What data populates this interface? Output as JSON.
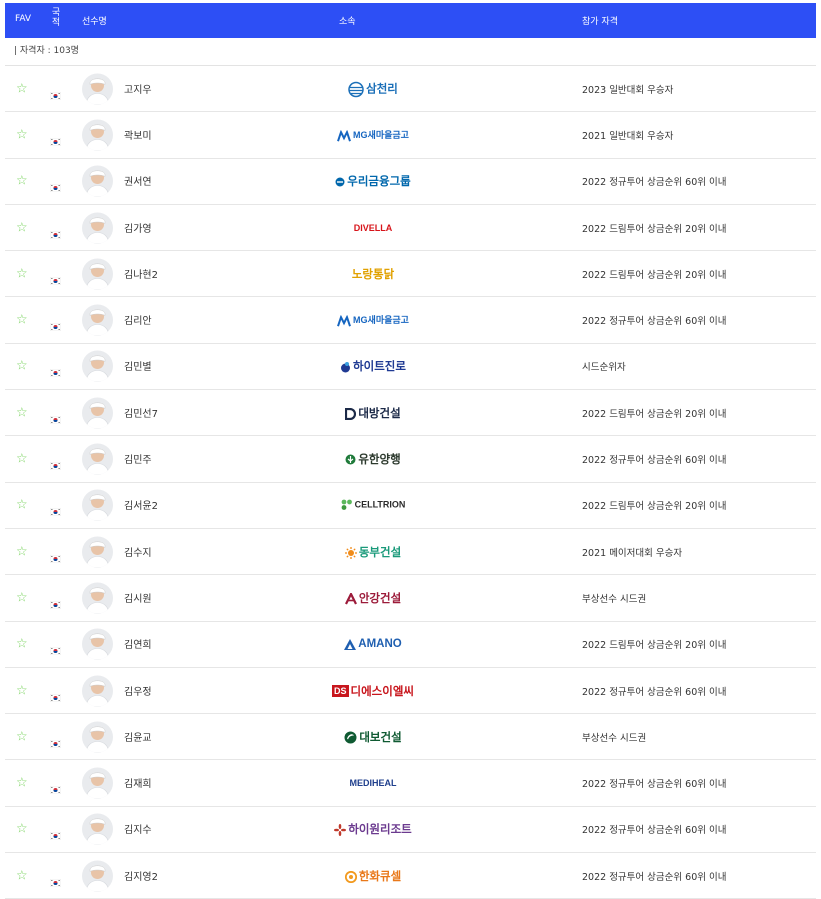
{
  "header": {
    "fav": "FAV",
    "nationality": "국적",
    "player": "선수명",
    "affiliation": "소속",
    "qualification": "참가 자격"
  },
  "count_text": "| 자격자 : 103명",
  "colors": {
    "header_bg": "#2d4ff5",
    "star": "#7ad35f"
  },
  "rows": [
    {
      "name": "고지우",
      "sponsor": "삼천리",
      "sponsor_color": "#1b6fb8",
      "sponsor_icon": "globe-icon",
      "qual": "2023 일반대회 우승자"
    },
    {
      "name": "곽보미",
      "sponsor": "MG새마을금고",
      "sponsor_color": "#1565c0",
      "sponsor_icon": "mg-icon",
      "qual": "2021 일반대회 우승자"
    },
    {
      "name": "권서연",
      "sponsor": "우리금융그룹",
      "sponsor_color": "#0067ac",
      "sponsor_icon": "circle-icon",
      "qual": "2022 정규투어 상금순위 60위 이내"
    },
    {
      "name": "김가영",
      "sponsor": "DIVELLA",
      "sponsor_color": "#d7141a",
      "sponsor_icon": "",
      "qual": "2022 드림투어 상금순위 20위 이내"
    },
    {
      "name": "김나현2",
      "sponsor": "노랑통닭",
      "sponsor_color": "#e1a100",
      "sponsor_icon": "",
      "qual": "2022 드림투어 상금순위 20위 이내"
    },
    {
      "name": "김리안",
      "sponsor": "MG새마을금고",
      "sponsor_color": "#1565c0",
      "sponsor_icon": "mg-icon",
      "qual": "2022 정규투어 상금순위 60위 이내"
    },
    {
      "name": "김민별",
      "sponsor": "하이트진로",
      "sponsor_color": "#1f3a93",
      "sponsor_icon": "drop-icon",
      "qual": "시드순위자"
    },
    {
      "name": "김민선7",
      "sponsor": "대방건설",
      "sponsor_color": "#1c2a48",
      "sponsor_icon": "d-icon",
      "qual": "2022 드림투어 상금순위 20위 이내"
    },
    {
      "name": "김민주",
      "sponsor": "유한양행",
      "sponsor_color": "#2d3a2e",
      "sponsor_icon": "leaf-icon",
      "qual": "2022 정규투어 상금순위 60위 이내"
    },
    {
      "name": "김서윤2",
      "sponsor": "CELLTRION",
      "sponsor_color": "#2b2b2b",
      "sponsor_icon": "cells-icon",
      "qual": "2022 드림투어 상금순위 20위 이내"
    },
    {
      "name": "김수지",
      "sponsor": "동부건설",
      "sponsor_color": "#1a9a7a",
      "sponsor_icon": "sun-icon",
      "qual": "2021 메이저대회 우승자"
    },
    {
      "name": "김시원",
      "sponsor": "안강건설",
      "sponsor_color": "#9c1b3a",
      "sponsor_icon": "a-icon",
      "qual": "부상선수 시드권"
    },
    {
      "name": "김연희",
      "sponsor": "AMANO",
      "sponsor_color": "#1f5fb0",
      "sponsor_icon": "triangle-icon",
      "qual": "2022 드림투어 상금순위 20위 이내"
    },
    {
      "name": "김우정",
      "sponsor": "디에스이엘씨",
      "sponsor_color": "#c8161d",
      "sponsor_icon": "ds-icon",
      "qual": "2022 정규투어 상금순위 60위 이내"
    },
    {
      "name": "김윤교",
      "sponsor": "대보건설",
      "sponsor_color": "#0f5a32",
      "sponsor_icon": "e-icon",
      "qual": "부상선수 시드권"
    },
    {
      "name": "김재희",
      "sponsor": "MEDIHEAL",
      "sponsor_color": "#1f3f8c",
      "sponsor_icon": "",
      "qual": "2022 정규투어 상금순위 60위 이내"
    },
    {
      "name": "김지수",
      "sponsor": "하이원리조트",
      "sponsor_color": "#6b3a8f",
      "sponsor_icon": "flower-icon",
      "qual": "2022 정규투어 상금순위 60위 이내"
    },
    {
      "name": "김지영2",
      "sponsor": "한화큐셀",
      "sponsor_color": "#e9781a",
      "sponsor_icon": "swirl-icon",
      "qual": "2022 정규투어 상금순위 60위 이내"
    }
  ]
}
